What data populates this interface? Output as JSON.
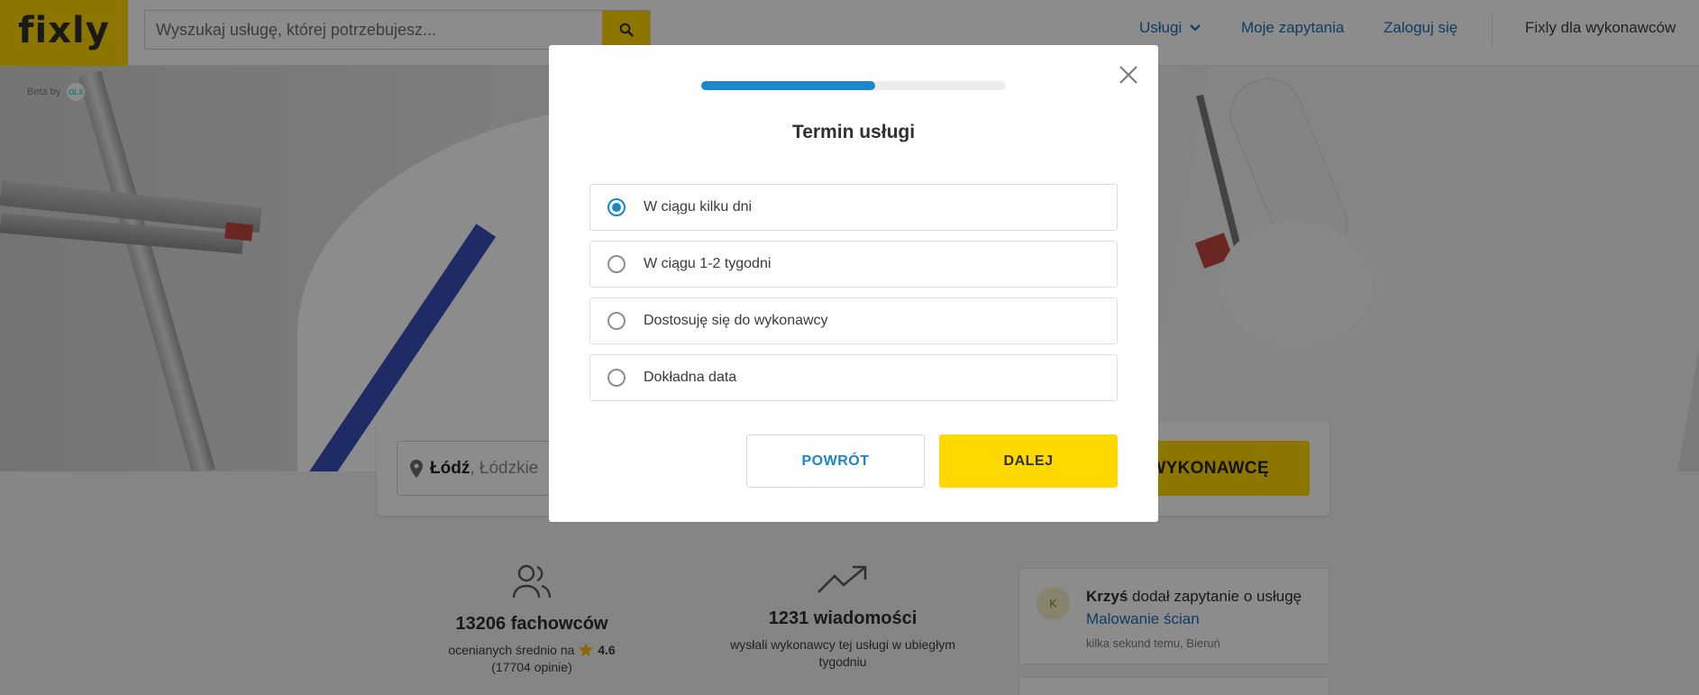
{
  "header": {
    "logo_text": "fixly",
    "search_placeholder": "Wyszukaj usługę, której potrzebujesz...",
    "search_button_icon": "search-icon",
    "nav": {
      "services": "Usługi",
      "my_requests": "Moje zapytania",
      "login": "Zaloguj się",
      "for_pros": "Fixly dla wykonawców"
    }
  },
  "hero": {
    "beta_label": "Beta by",
    "olx_label": "OLX",
    "location_city": "Łódź",
    "location_region": ", Łódzkie",
    "find_button": "ZNAJDŹ WYKONAWCĘ"
  },
  "stats": [
    {
      "icon": "users-icon",
      "title": "13206 fachowców",
      "sub_prefix": "ocenianych średnio na",
      "rating_icon": "star-icon",
      "rating": "4.6",
      "sub_suffix": "(17704 opinie)"
    },
    {
      "icon": "trending-up-icon",
      "title": "1231 wiadomości",
      "sub": "wysłali wykonawcy tej usługi w ubiegłym tygodniu"
    }
  ],
  "activity": {
    "avatar_initial": "K",
    "name": "Krzyś",
    "action": " dodał zapytanie o usługę ",
    "service": "Malowanie ścian",
    "meta": "kilka sekund temu, Bieruń"
  },
  "modal": {
    "title": "Termin usługi",
    "progress": 0.57,
    "options": [
      {
        "label": "W ciągu kilku dni",
        "selected": true
      },
      {
        "label": "W ciągu 1-2 tygodni",
        "selected": false
      },
      {
        "label": "Dostosuję się do wykonawcy",
        "selected": false
      },
      {
        "label": "Dokładna data",
        "selected": false
      }
    ],
    "back_button": "POWRÓT",
    "next_button": "DALEJ"
  },
  "colors": {
    "brand_yellow": "#ffd800",
    "link_blue": "#1b6fae",
    "accent_blue": "#1b87c9"
  }
}
